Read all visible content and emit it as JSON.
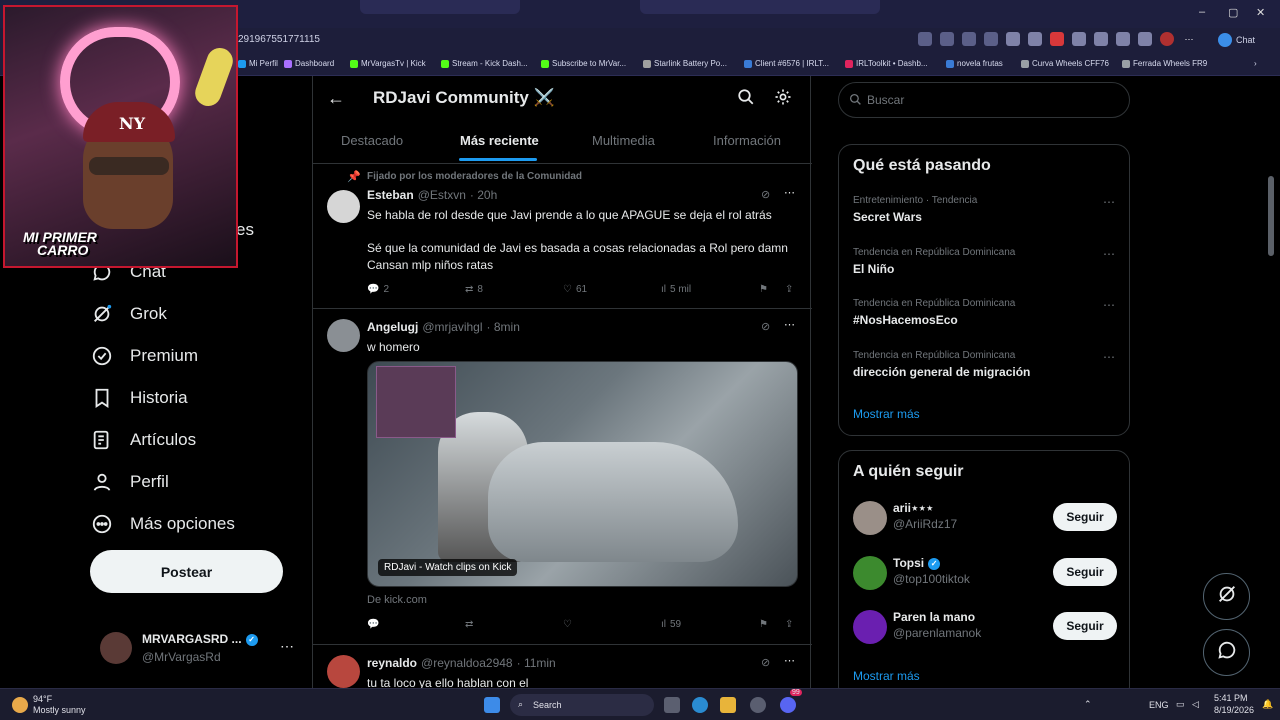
{
  "browser": {
    "url": "291967551771115",
    "copilot_label": "Chat",
    "bookmarks": [
      {
        "label": "Mi Perfil",
        "color": "#1d9bf0"
      },
      {
        "label": "Dashboard",
        "color": "#a970ff"
      },
      {
        "label": "MrVargasTv | Kick",
        "color": "#53fc18"
      },
      {
        "label": "Stream - Kick Dash...",
        "color": "#53fc18"
      },
      {
        "label": "Subscribe to MrVar...",
        "color": "#53fc18"
      },
      {
        "label": "Starlink Battery Po...",
        "color": "#a0a0a0"
      },
      {
        "label": "Client #6576 | IRLT...",
        "color": "#3a7bd5"
      },
      {
        "label": "IRLToolkit • Dashb...",
        "color": "#e0245e"
      },
      {
        "label": "novela frutas",
        "color": "#3a7bd5"
      },
      {
        "label": "Curva Wheels CFF76",
        "color": "#9aa0a6"
      },
      {
        "label": "Ferrada Wheels FR9",
        "color": "#9aa0a6"
      }
    ]
  },
  "webcam": {
    "overlay_line1": "MI PRIMER",
    "overlay_line2": "CARRO",
    "cap_logo": "NY"
  },
  "leftnav": {
    "items": [
      {
        "label": "Chat",
        "icon": "chat-icon"
      },
      {
        "label": "Grok",
        "icon": "grok-icon"
      },
      {
        "label": "Premium",
        "icon": "premium-icon"
      },
      {
        "label": "Historia",
        "icon": "bookmark-icon"
      },
      {
        "label": "Artículos",
        "icon": "articles-icon"
      },
      {
        "label": "Perfil",
        "icon": "profile-icon"
      },
      {
        "label": "Más opciones",
        "icon": "more-options-icon"
      }
    ],
    "partial_label": "es",
    "post_button": "Postear",
    "account": {
      "name": "MRVARGASRD ...",
      "handle": "@MrVargasRd"
    }
  },
  "community": {
    "title": "RDJavi Community ⚔️",
    "tabs": [
      "Destacado",
      "Más reciente",
      "Multimedia",
      "Información"
    ],
    "active_tab": 1
  },
  "tweets": [
    {
      "pinned_label": "Fijado por los moderadores de la Comunidad",
      "name": "Esteban",
      "handle": "@Estxvn",
      "time": "· 20h",
      "text1": "Se habla de rol desde que Javi prende a lo que APAGUE se deja el rol atrás",
      "text2": "Sé que la comunidad de Javi es basada a cosas relacionadas a Rol pero damn Cansan mlp niños ratas",
      "replies": "2",
      "reposts": "8",
      "likes": "61",
      "views": "5 mil"
    },
    {
      "name": "Angelugj",
      "handle": "@mrjavihgl",
      "time": "· 8min",
      "text1": "w homero",
      "media_caption": "RDJavi - Watch clips on Kick",
      "source": "De kick.com",
      "views": "59"
    },
    {
      "name": "reynaldo",
      "handle": "@reynaldoa2948",
      "time": "· 11min",
      "text1": "tu ta loco ya ello hablan con el"
    }
  ],
  "search": {
    "placeholder": "Buscar"
  },
  "trends": {
    "title": "Qué está pasando",
    "items": [
      {
        "category": "Entretenimiento · Tendencia",
        "topic": "Secret Wars"
      },
      {
        "category": "Tendencia en República Dominicana",
        "topic": "El Niño"
      },
      {
        "category": "Tendencia en República Dominicana",
        "topic": "#NosHacemosEco"
      },
      {
        "category": "Tendencia en República Dominicana",
        "topic": "dirección general de migración"
      }
    ],
    "show_more": "Mostrar más"
  },
  "who_to_follow": {
    "title": "A quién seguir",
    "items": [
      {
        "name": "arii⋆⋆⋆",
        "handle": "@AriiRdz17",
        "button": "Seguir",
        "color": "#9a8f88"
      },
      {
        "name": "Topsi",
        "handle": "@top100tiktok",
        "button": "Seguir",
        "color": "#3c8a2e"
      },
      {
        "name": "Paren la mano",
        "handle": "@parenlamanok",
        "button": "Seguir",
        "color": "#6a1fb0"
      }
    ],
    "show_more": "Mostrar más"
  },
  "taskbar": {
    "weather_temp": "94°F",
    "weather_desc": "Mostly sunny",
    "search_label": "Search",
    "lang": "ENG",
    "time": "5:41 PM",
    "date": "8/19/2026",
    "badge": "99"
  },
  "colors": {
    "accent": "#1d9bf0",
    "background": "#000000",
    "border": "#2f3336"
  }
}
